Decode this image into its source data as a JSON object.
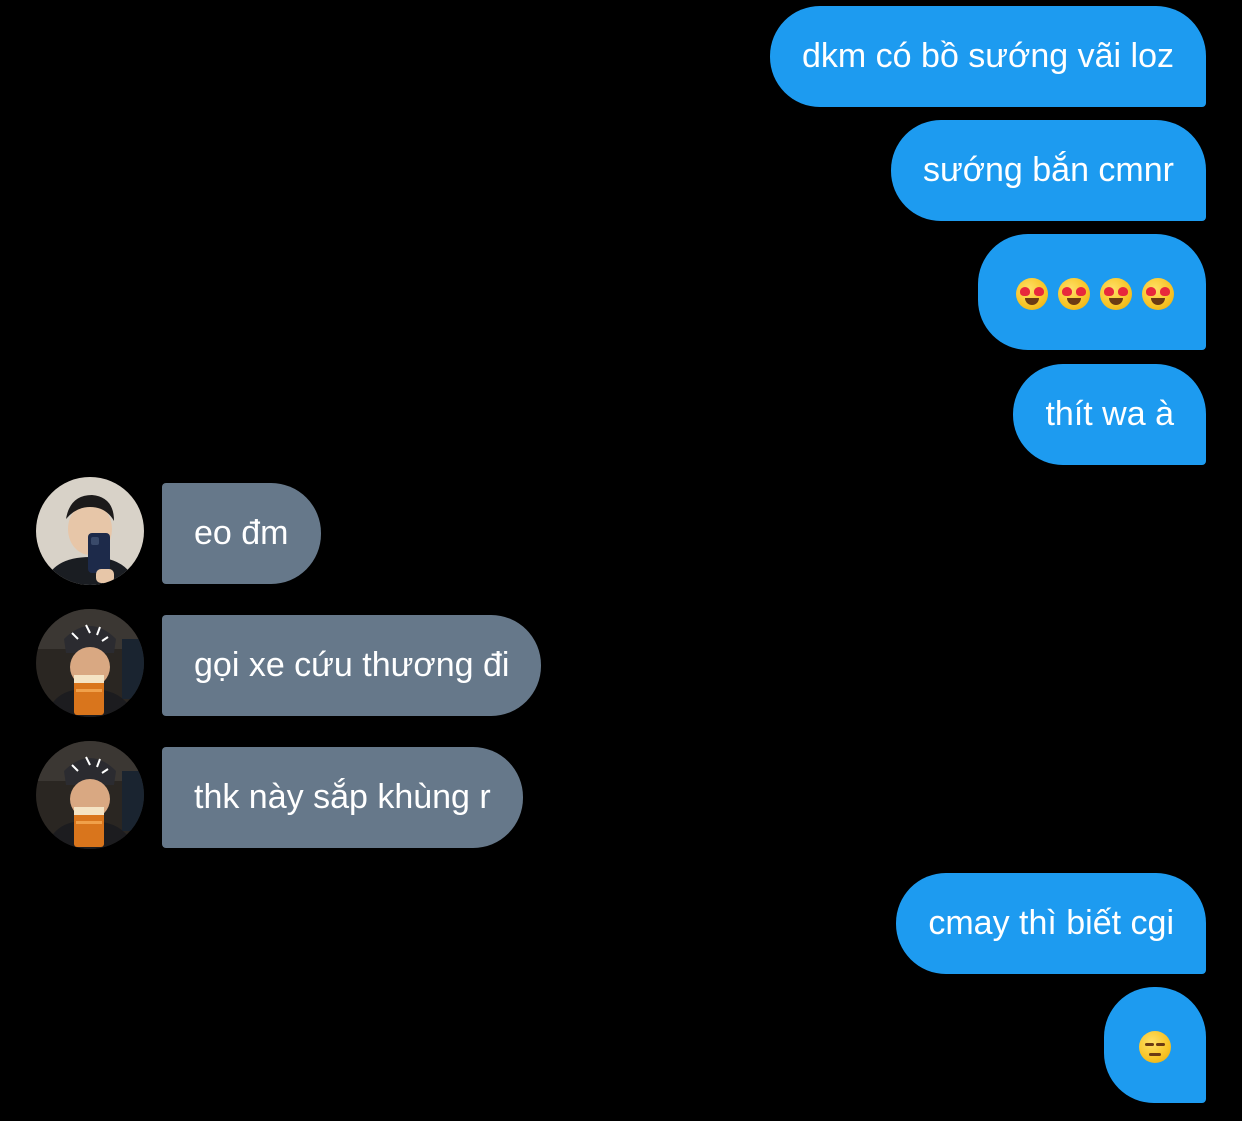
{
  "colors": {
    "background": "#000000",
    "sent_bubble": "#1d9bf0",
    "received_bubble": "#66788a",
    "text": "#ffffff"
  },
  "messages": [
    {
      "direction": "sent",
      "text": "dkm có bồ sướng vãi loz"
    },
    {
      "direction": "sent",
      "text": "sướng bắn cmnr"
    },
    {
      "direction": "sent",
      "emoji": [
        "smiling-face-with-heart-eyes",
        "smiling-face-with-heart-eyes",
        "smiling-face-with-heart-eyes",
        "smiling-face-with-heart-eyes"
      ]
    },
    {
      "direction": "sent",
      "text": "thít wa à"
    },
    {
      "direction": "received",
      "text": "eo đm",
      "avatar": "avatar-mirror-selfie"
    },
    {
      "direction": "received",
      "text": "gọi xe cứu thương đi",
      "avatar": "avatar-beer-glass"
    },
    {
      "direction": "received",
      "text": "thk này sắp khùng r",
      "avatar": "avatar-beer-glass"
    },
    {
      "direction": "sent",
      "text": "cmay thì biết cgi"
    },
    {
      "direction": "sent",
      "emoji": [
        "unamused-face"
      ]
    }
  ]
}
